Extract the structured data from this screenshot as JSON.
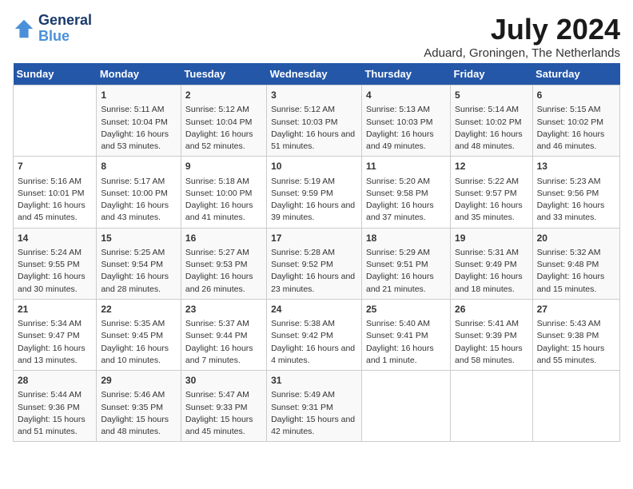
{
  "header": {
    "logo_line1": "General",
    "logo_line2": "Blue",
    "title": "July 2024",
    "location": "Aduard, Groningen, The Netherlands"
  },
  "days_of_week": [
    "Sunday",
    "Monday",
    "Tuesday",
    "Wednesday",
    "Thursday",
    "Friday",
    "Saturday"
  ],
  "weeks": [
    [
      {
        "day": "",
        "sunrise": "",
        "sunset": "",
        "daylight": ""
      },
      {
        "day": "1",
        "sunrise": "Sunrise: 5:11 AM",
        "sunset": "Sunset: 10:04 PM",
        "daylight": "Daylight: 16 hours and 53 minutes."
      },
      {
        "day": "2",
        "sunrise": "Sunrise: 5:12 AM",
        "sunset": "Sunset: 10:04 PM",
        "daylight": "Daylight: 16 hours and 52 minutes."
      },
      {
        "day": "3",
        "sunrise": "Sunrise: 5:12 AM",
        "sunset": "Sunset: 10:03 PM",
        "daylight": "Daylight: 16 hours and 51 minutes."
      },
      {
        "day": "4",
        "sunrise": "Sunrise: 5:13 AM",
        "sunset": "Sunset: 10:03 PM",
        "daylight": "Daylight: 16 hours and 49 minutes."
      },
      {
        "day": "5",
        "sunrise": "Sunrise: 5:14 AM",
        "sunset": "Sunset: 10:02 PM",
        "daylight": "Daylight: 16 hours and 48 minutes."
      },
      {
        "day": "6",
        "sunrise": "Sunrise: 5:15 AM",
        "sunset": "Sunset: 10:02 PM",
        "daylight": "Daylight: 16 hours and 46 minutes."
      }
    ],
    [
      {
        "day": "7",
        "sunrise": "Sunrise: 5:16 AM",
        "sunset": "Sunset: 10:01 PM",
        "daylight": "Daylight: 16 hours and 45 minutes."
      },
      {
        "day": "8",
        "sunrise": "Sunrise: 5:17 AM",
        "sunset": "Sunset: 10:00 PM",
        "daylight": "Daylight: 16 hours and 43 minutes."
      },
      {
        "day": "9",
        "sunrise": "Sunrise: 5:18 AM",
        "sunset": "Sunset: 10:00 PM",
        "daylight": "Daylight: 16 hours and 41 minutes."
      },
      {
        "day": "10",
        "sunrise": "Sunrise: 5:19 AM",
        "sunset": "Sunset: 9:59 PM",
        "daylight": "Daylight: 16 hours and 39 minutes."
      },
      {
        "day": "11",
        "sunrise": "Sunrise: 5:20 AM",
        "sunset": "Sunset: 9:58 PM",
        "daylight": "Daylight: 16 hours and 37 minutes."
      },
      {
        "day": "12",
        "sunrise": "Sunrise: 5:22 AM",
        "sunset": "Sunset: 9:57 PM",
        "daylight": "Daylight: 16 hours and 35 minutes."
      },
      {
        "day": "13",
        "sunrise": "Sunrise: 5:23 AM",
        "sunset": "Sunset: 9:56 PM",
        "daylight": "Daylight: 16 hours and 33 minutes."
      }
    ],
    [
      {
        "day": "14",
        "sunrise": "Sunrise: 5:24 AM",
        "sunset": "Sunset: 9:55 PM",
        "daylight": "Daylight: 16 hours and 30 minutes."
      },
      {
        "day": "15",
        "sunrise": "Sunrise: 5:25 AM",
        "sunset": "Sunset: 9:54 PM",
        "daylight": "Daylight: 16 hours and 28 minutes."
      },
      {
        "day": "16",
        "sunrise": "Sunrise: 5:27 AM",
        "sunset": "Sunset: 9:53 PM",
        "daylight": "Daylight: 16 hours and 26 minutes."
      },
      {
        "day": "17",
        "sunrise": "Sunrise: 5:28 AM",
        "sunset": "Sunset: 9:52 PM",
        "daylight": "Daylight: 16 hours and 23 minutes."
      },
      {
        "day": "18",
        "sunrise": "Sunrise: 5:29 AM",
        "sunset": "Sunset: 9:51 PM",
        "daylight": "Daylight: 16 hours and 21 minutes."
      },
      {
        "day": "19",
        "sunrise": "Sunrise: 5:31 AM",
        "sunset": "Sunset: 9:49 PM",
        "daylight": "Daylight: 16 hours and 18 minutes."
      },
      {
        "day": "20",
        "sunrise": "Sunrise: 5:32 AM",
        "sunset": "Sunset: 9:48 PM",
        "daylight": "Daylight: 16 hours and 15 minutes."
      }
    ],
    [
      {
        "day": "21",
        "sunrise": "Sunrise: 5:34 AM",
        "sunset": "Sunset: 9:47 PM",
        "daylight": "Daylight: 16 hours and 13 minutes."
      },
      {
        "day": "22",
        "sunrise": "Sunrise: 5:35 AM",
        "sunset": "Sunset: 9:45 PM",
        "daylight": "Daylight: 16 hours and 10 minutes."
      },
      {
        "day": "23",
        "sunrise": "Sunrise: 5:37 AM",
        "sunset": "Sunset: 9:44 PM",
        "daylight": "Daylight: 16 hours and 7 minutes."
      },
      {
        "day": "24",
        "sunrise": "Sunrise: 5:38 AM",
        "sunset": "Sunset: 9:42 PM",
        "daylight": "Daylight: 16 hours and 4 minutes."
      },
      {
        "day": "25",
        "sunrise": "Sunrise: 5:40 AM",
        "sunset": "Sunset: 9:41 PM",
        "daylight": "Daylight: 16 hours and 1 minute."
      },
      {
        "day": "26",
        "sunrise": "Sunrise: 5:41 AM",
        "sunset": "Sunset: 9:39 PM",
        "daylight": "Daylight: 15 hours and 58 minutes."
      },
      {
        "day": "27",
        "sunrise": "Sunrise: 5:43 AM",
        "sunset": "Sunset: 9:38 PM",
        "daylight": "Daylight: 15 hours and 55 minutes."
      }
    ],
    [
      {
        "day": "28",
        "sunrise": "Sunrise: 5:44 AM",
        "sunset": "Sunset: 9:36 PM",
        "daylight": "Daylight: 15 hours and 51 minutes."
      },
      {
        "day": "29",
        "sunrise": "Sunrise: 5:46 AM",
        "sunset": "Sunset: 9:35 PM",
        "daylight": "Daylight: 15 hours and 48 minutes."
      },
      {
        "day": "30",
        "sunrise": "Sunrise: 5:47 AM",
        "sunset": "Sunset: 9:33 PM",
        "daylight": "Daylight: 15 hours and 45 minutes."
      },
      {
        "day": "31",
        "sunrise": "Sunrise: 5:49 AM",
        "sunset": "Sunset: 9:31 PM",
        "daylight": "Daylight: 15 hours and 42 minutes."
      },
      {
        "day": "",
        "sunrise": "",
        "sunset": "",
        "daylight": ""
      },
      {
        "day": "",
        "sunrise": "",
        "sunset": "",
        "daylight": ""
      },
      {
        "day": "",
        "sunrise": "",
        "sunset": "",
        "daylight": ""
      }
    ]
  ]
}
